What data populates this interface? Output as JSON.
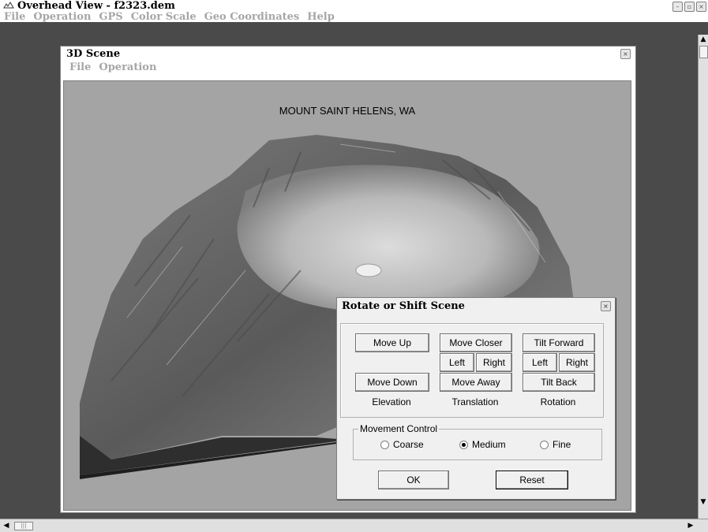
{
  "app": {
    "title": "Overhead View - f2323.dem",
    "menu": [
      "File",
      "Operation",
      "GPS",
      "Color Scale",
      "Geo Coordinates",
      "Help"
    ]
  },
  "scene_window": {
    "title": "3D Scene",
    "menu": [
      "File",
      "Operation"
    ],
    "viewport_title": "MOUNT SAINT HELENS, WA"
  },
  "dialog": {
    "title": "Rotate or Shift Scene",
    "buttons": {
      "move_up": "Move Up",
      "move_down": "Move Down",
      "move_closer": "Move Closer",
      "move_away": "Move Away",
      "translate_left": "Left",
      "translate_right": "Right",
      "tilt_forward": "Tilt Forward",
      "tilt_back": "Tilt Back",
      "rotate_left": "Left",
      "rotate_right": "Right"
    },
    "group_labels": {
      "elevation": "Elevation",
      "translation": "Translation",
      "rotation": "Rotation"
    },
    "movement_control": {
      "legend": "Movement Control",
      "options": [
        "Coarse",
        "Medium",
        "Fine"
      ],
      "selected": "Medium"
    },
    "ok": "OK",
    "reset": "Reset"
  },
  "colors": {
    "workspace": "#4a4a4a",
    "viewport_bg": "#a4a4a4",
    "menu_text": "#a6a6a6"
  }
}
